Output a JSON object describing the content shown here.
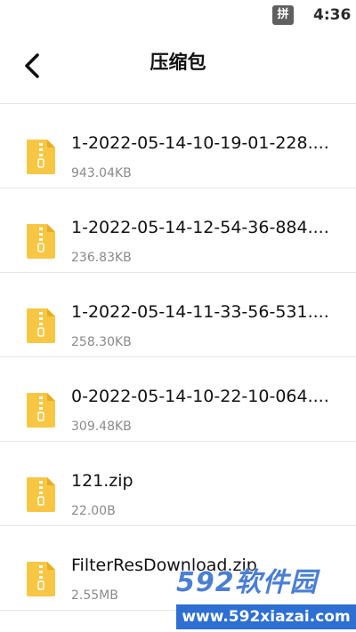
{
  "status_bar": {
    "ime_label": "拼",
    "time": "4:36"
  },
  "header": {
    "title": "压缩包"
  },
  "files": [
    {
      "name": "1-2022-05-14-10-19-01-228....",
      "size": "943.04KB"
    },
    {
      "name": "1-2022-05-14-12-54-36-884....",
      "size": "236.83KB"
    },
    {
      "name": "1-2022-05-14-11-33-56-531....",
      "size": "258.30KB"
    },
    {
      "name": "0-2022-05-14-10-22-10-064....",
      "size": "309.48KB"
    },
    {
      "name": "121.zip",
      "size": "22.00B"
    },
    {
      "name": "FilterResDownload.zip",
      "size": "2.55MB"
    }
  ],
  "watermark": {
    "logo": "592软件园",
    "url": "www.592xiazai.com"
  },
  "colors": {
    "zip_icon": "#f7c744",
    "zip_icon_fold": "#e7ae23",
    "watermark_blue": "#2d6fd2"
  }
}
